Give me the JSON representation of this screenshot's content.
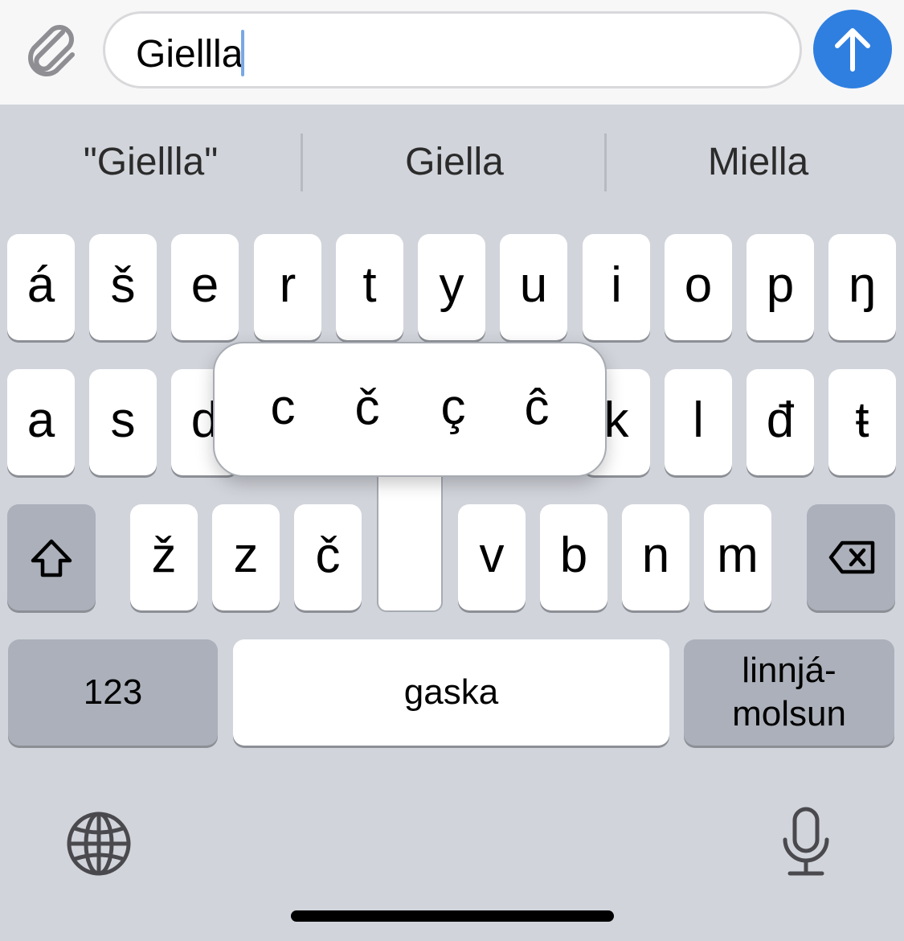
{
  "composer": {
    "text": "Giellla",
    "attach_icon": "paperclip-icon",
    "send_icon": "arrow-up-icon",
    "send_color": "#2f7fe0"
  },
  "suggestions": [
    "\"Giellla\"",
    "Giella",
    "Miella"
  ],
  "keyboard": {
    "row1": [
      "á",
      "š",
      "e",
      "r",
      "t",
      "y",
      "u",
      "i",
      "o",
      "p",
      "ŋ"
    ],
    "row2_left": [
      "a",
      "s",
      "d"
    ],
    "row2_right": [
      "k",
      "l",
      "đ",
      "ŧ"
    ],
    "row3": [
      "ž",
      "z",
      "č",
      "v",
      "b",
      "n",
      "m"
    ],
    "popup_options": [
      "c",
      "č",
      "ç",
      "ĉ"
    ],
    "numbers_label": "123",
    "space_label": "gaska",
    "return_label_line1": "linnjá-",
    "return_label_line2": "molsun",
    "shift_icon": "shift-icon",
    "delete_icon": "delete-icon",
    "globe_icon": "globe-icon",
    "mic_icon": "microphone-icon"
  }
}
